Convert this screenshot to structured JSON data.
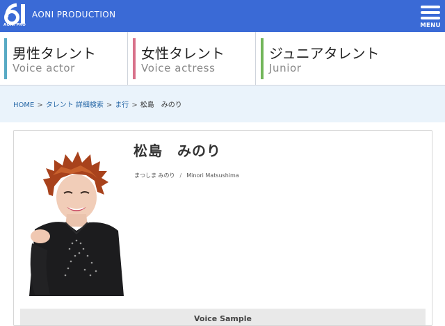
{
  "header": {
    "logo_mark": "81",
    "logo_sub": "AONI PRO",
    "brand_name": "AONI PRODUCTION",
    "menu_label": "MENU",
    "bg_color": "#3a6ad6"
  },
  "categories": [
    {
      "jp": "男性タレント",
      "en": "Voice actor",
      "accent": "#58aac4"
    },
    {
      "jp": "女性タレント",
      "en": "Voice actress",
      "accent": "#d8718a"
    },
    {
      "jp": "ジュニアタレント",
      "en": "Junior",
      "accent": "#72b65a"
    }
  ],
  "breadcrumb": {
    "home": "HOME",
    "search": "タレント 詳細検索",
    "row": "ま行",
    "current": "松島　みのり",
    "separator": ">"
  },
  "profile": {
    "name": "松島　みのり",
    "reading_jp": "まつしま みのり",
    "slash": "/",
    "reading_en": "Minori Matsushima",
    "voice_sample_label": "Voice Sample"
  }
}
